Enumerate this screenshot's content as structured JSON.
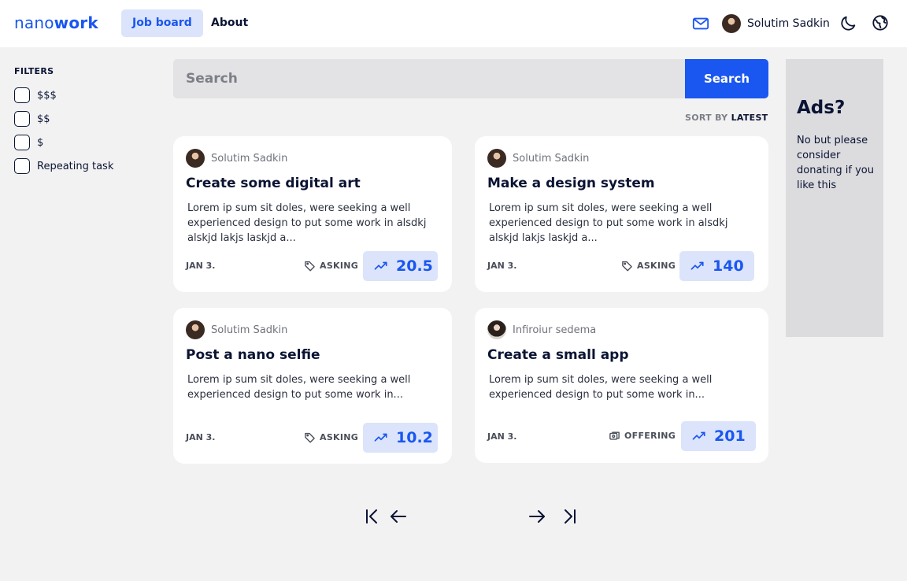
{
  "header": {
    "logo_light": "nano",
    "logo_bold": "work",
    "nav": [
      {
        "label": "Job board",
        "active": true
      },
      {
        "label": "About",
        "active": false
      }
    ],
    "user_name": "Solutim Sadkin",
    "icons": [
      "mail-icon",
      "moon-icon",
      "globe-icon"
    ]
  },
  "filters": {
    "title": "FILTERS",
    "options": [
      {
        "label": "$$$",
        "checked": false
      },
      {
        "label": "$$",
        "checked": false
      },
      {
        "label": "$",
        "checked": false
      },
      {
        "label": "Repeating task",
        "checked": false
      }
    ]
  },
  "search": {
    "placeholder": "Search",
    "value": "",
    "button_label": "Search"
  },
  "sort": {
    "label": "SORT BY",
    "value": "LATEST"
  },
  "jobs": [
    {
      "author": "Solutim Sadkin",
      "title": "Create some digital art",
      "description": "Lorem ip sum sit doles, were seeking a well experienced design to put some work in alsdkj alskjd lakjs laskjd a...",
      "date": "JAN 3.",
      "type": "ASKING",
      "price": "20.5"
    },
    {
      "author": "Solutim Sadkin",
      "title": "Make a design system",
      "description": "Lorem ip sum sit doles, were seeking a well experienced design to put some work in alsdkj alskjd lakjs laskjd a...",
      "date": "JAN 3.",
      "type": "ASKING",
      "price": "140"
    },
    {
      "author": "Solutim Sadkin",
      "title": "Post a nano selfie",
      "description": "Lorem ip sum sit doles, were seeking a well experienced design to put some work in...",
      "date": "JAN 3.",
      "type": "ASKING",
      "price": "10.2"
    },
    {
      "author": "Infiroiur sedema",
      "title": "Create a small app",
      "description": "Lorem ip sum sit doles, were seeking a well experienced design to put some work in...",
      "date": "JAN 3.",
      "type": "OFFERING",
      "price": "201"
    }
  ],
  "ads": {
    "title": "Ads?",
    "text": "No but please consider donating if you like this"
  },
  "colors": {
    "accent": "#1a56f0",
    "accent_light": "#dbe4fb",
    "text": "#0b1433",
    "background": "#f2f2f3"
  }
}
